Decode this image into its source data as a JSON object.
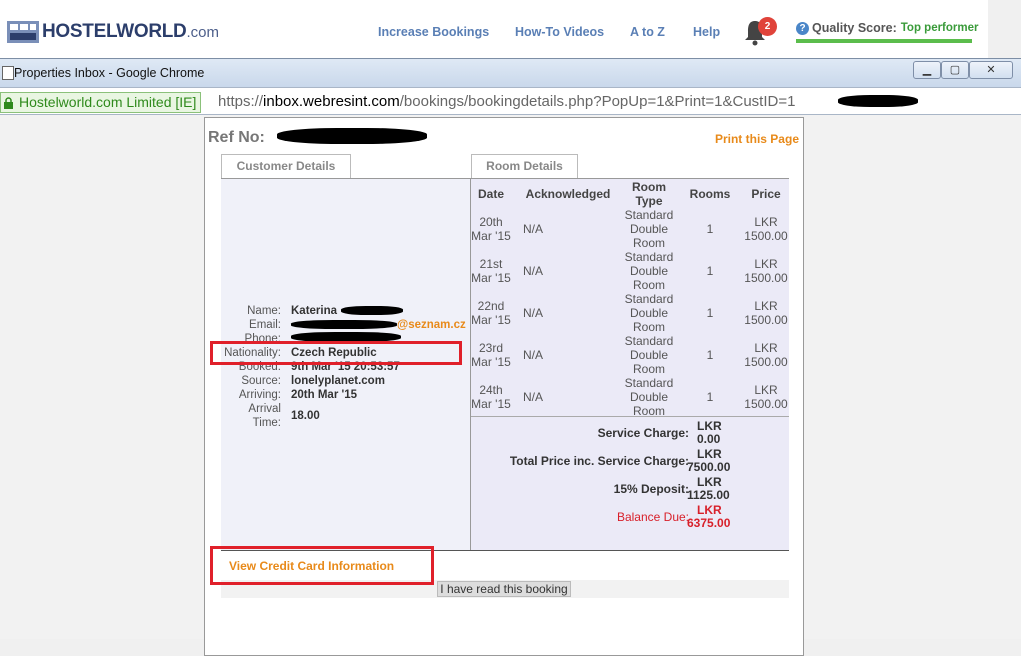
{
  "header": {
    "logo_word": "HOSTELWORLD",
    "logo_suffix": ".com",
    "nav": [
      "Increase Bookings",
      "How-To Videos",
      "A to Z",
      "Help"
    ],
    "notification_count": "2",
    "quality_label": "Quality Score:",
    "quality_value": "Top performer"
  },
  "window": {
    "title": "Properties Inbox - Google Chrome",
    "secure_label": "Hostelworld.com Limited [IE]",
    "url_prefix": "https://",
    "url_host": "inbox.webresint.com",
    "url_path": "/bookings/bookingdetails.php?PopUp=1&Print=1&CustID=",
    "url_tail": "1"
  },
  "booking": {
    "ref_label": "Ref No:",
    "print_label": "Print this Page",
    "tabs": [
      "Customer Details",
      "Room Details"
    ],
    "customer": {
      "name_label": "Name:",
      "name_value": "Katerina",
      "email_label": "Email:",
      "email_value": "@seznam.cz",
      "phone_label": "Phone:",
      "nationality_label": "Nationality:",
      "nationality_value": "Czech Republic",
      "booked_label": "Booked:",
      "booked_value": "9th Mar '15 20:53:57",
      "source_label": "Source:",
      "source_value": "lonelyplanet.com",
      "arriving_label": "Arriving:",
      "arriving_value": "20th Mar '15",
      "arrival_time_label1": "Arrival",
      "arrival_time_label2": "Time:",
      "arrival_time_value": "18.00"
    },
    "rooms": {
      "headers": [
        "Date",
        "Acknowledged",
        "Room",
        "Type",
        "Rooms",
        "Price"
      ],
      "rows": [
        {
          "date1": "20th",
          "date2": "Mar '15",
          "ack": "N/A",
          "type1": "Standard",
          "type2": "Double",
          "type3": "Room",
          "rooms": "1",
          "price1": "LKR",
          "price2": "1500.00"
        },
        {
          "date1": "21st",
          "date2": "Mar '15",
          "ack": "N/A",
          "type1": "Standard",
          "type2": "Double",
          "type3": "Room",
          "rooms": "1",
          "price1": "LKR",
          "price2": "1500.00"
        },
        {
          "date1": "22nd",
          "date2": "Mar '15",
          "ack": "N/A",
          "type1": "Standard",
          "type2": "Double",
          "type3": "Room",
          "rooms": "1",
          "price1": "LKR",
          "price2": "1500.00"
        },
        {
          "date1": "23rd",
          "date2": "Mar '15",
          "ack": "N/A",
          "type1": "Standard",
          "type2": "Double",
          "type3": "Room",
          "rooms": "1",
          "price1": "LKR",
          "price2": "1500.00"
        },
        {
          "date1": "24th",
          "date2": "Mar '15",
          "ack": "N/A",
          "type1": "Standard",
          "type2": "Double",
          "type3": "Room",
          "rooms": "1",
          "price1": "LKR",
          "price2": "1500.00"
        }
      ]
    },
    "summary": {
      "service_label": "Service Charge:",
      "service_cur": "LKR",
      "service_val": "0.00",
      "total_label": "Total Price inc. Service Charge:",
      "total_cur": "LKR",
      "total_val": "7500.00",
      "deposit_label": "15% Deposit:",
      "deposit_cur": "LKR",
      "deposit_val": "1125.00",
      "balance_label": "Balance Due:",
      "balance_cur": "LKR",
      "balance_val": "6375.00"
    },
    "cc_link": "View Credit Card Information",
    "read_button": "I have read this booking"
  },
  "colors": {
    "accent_orange": "#e88a1a",
    "balance_red": "#d8202a",
    "highlight_red": "#e0202a",
    "quality_green": "#3a9b3a"
  }
}
